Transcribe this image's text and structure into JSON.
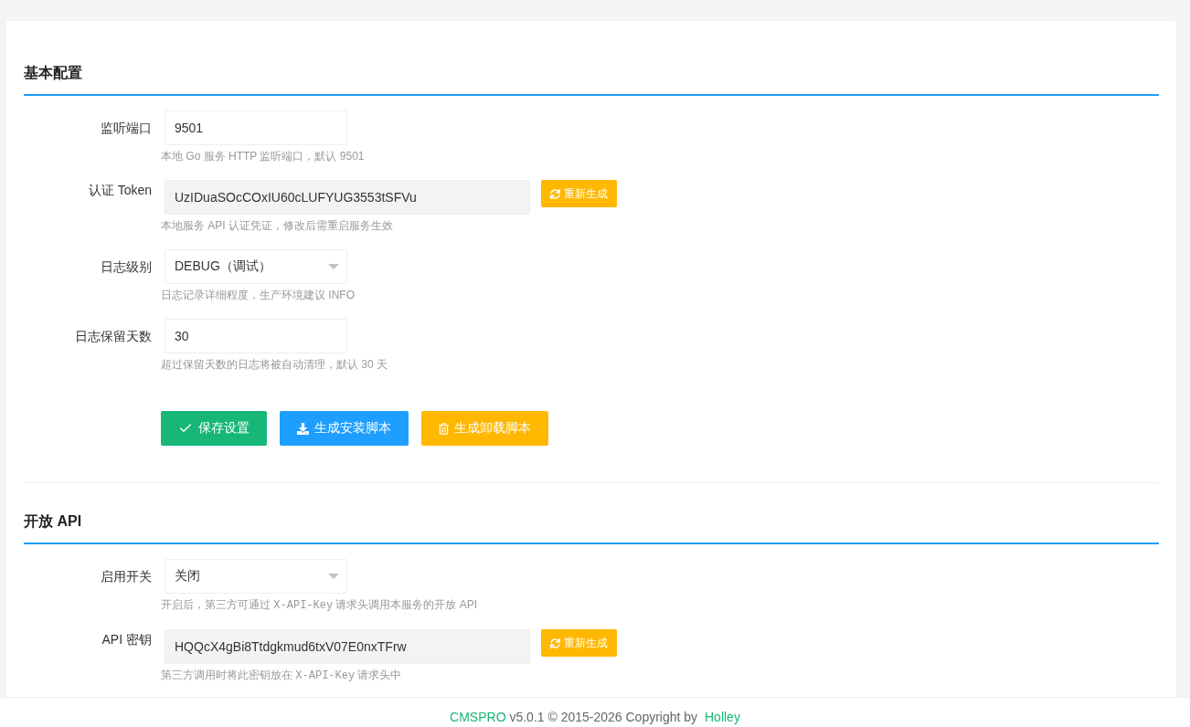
{
  "sections": [
    {
      "title": "基本配置",
      "fields": [
        {
          "label": "监听端口",
          "kind": "input",
          "value": "9501",
          "hint": [
            {
              "kind": "text",
              "text": "本地 Go 服务 HTTP 监听端口，默认 9501"
            }
          ]
        },
        {
          "label": "认证 Token",
          "kind": "readonly",
          "value": "UzIDuaSOcCOxIU60cLUFYUG3553tSFVu",
          "action": "重新生成",
          "hint": [
            {
              "kind": "text",
              "text": "本地服务 API 认证凭证，修改后需重启服务生效"
            }
          ]
        },
        {
          "label": "日志级别",
          "kind": "select",
          "value": "DEBUG（调试）",
          "hint": [
            {
              "kind": "text",
              "text": "日志记录详细程度，生产环境建议 INFO"
            }
          ]
        },
        {
          "label": "日志保留天数",
          "kind": "input",
          "value": "30",
          "hint": [
            {
              "kind": "text",
              "text": "超过保留天数的日志将被自动清理，默认 30 天"
            }
          ]
        }
      ],
      "buttons": [
        {
          "label": "保存设置",
          "kind": "save"
        },
        {
          "label": "生成安装脚本",
          "kind": "install"
        },
        {
          "label": "生成卸载脚本",
          "kind": "uninstall"
        }
      ]
    },
    {
      "title": "开放 API",
      "fields": [
        {
          "label": "启用开关",
          "kind": "select",
          "value": "关闭",
          "hint": [
            {
              "kind": "text",
              "text": "开启后，第三方可通过 "
            },
            {
              "kind": "code",
              "text": "X-API-Key"
            },
            {
              "kind": "text",
              "text": " 请求头调用本服务的开放 API"
            }
          ]
        },
        {
          "label": "API 密钥",
          "kind": "readonly",
          "value": "HQQcX4gBi8Ttdgkmud6txV07E0nxTFrw",
          "action": "重新生成",
          "hint": [
            {
              "kind": "text",
              "text": "第三方调用时将此密钥放在 "
            },
            {
              "kind": "code",
              "text": "X-API-Key"
            },
            {
              "kind": "text",
              "text": " 请求头中"
            }
          ]
        }
      ]
    }
  ],
  "footer": {
    "brand": "CMSPRO",
    "text": "v5.0.1 © 2015-2026 Copyright by",
    "author": "Holley"
  }
}
